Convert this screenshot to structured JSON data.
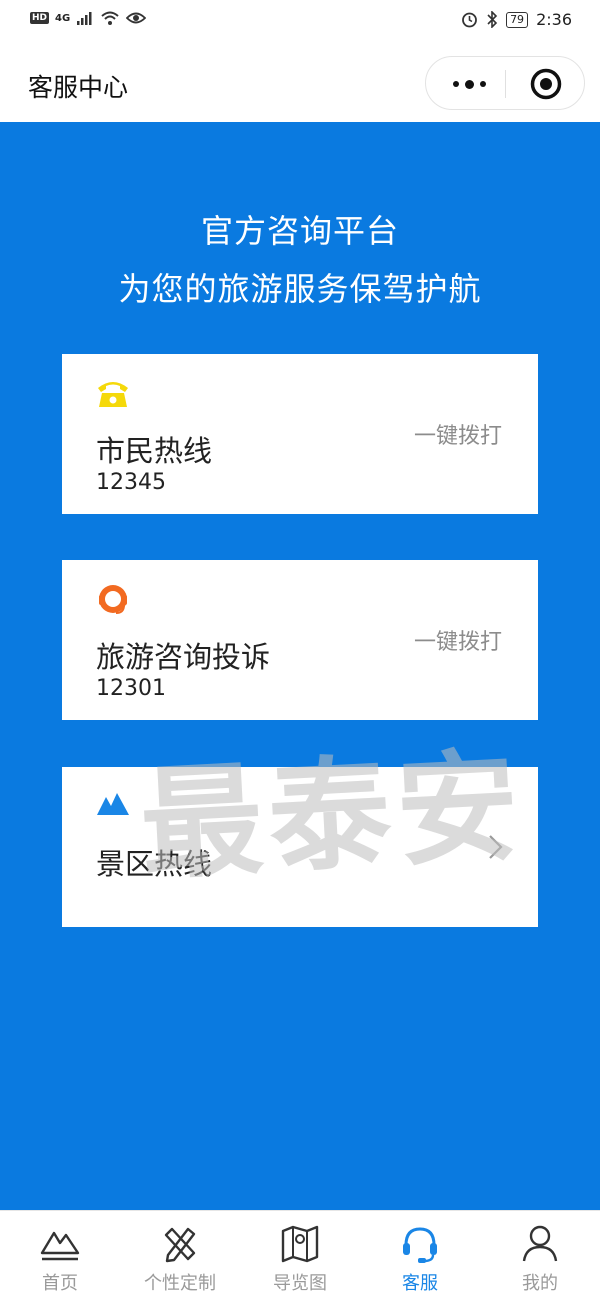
{
  "status_bar": {
    "hd_badge": "HD",
    "network": "4G",
    "battery": "79",
    "time": "2:36",
    "icons": [
      "signal-icon",
      "wifi-icon",
      "eye-icon",
      "alarm-icon",
      "bluetooth-icon",
      "battery-icon"
    ]
  },
  "navbar": {
    "title": "客服中心",
    "capsule_icons": [
      "more-dots-icon",
      "close-target-icon"
    ]
  },
  "hero": {
    "line1": "官方咨询平台",
    "line2": "为您的旅游服务保驾护航"
  },
  "cards": [
    {
      "title": "市民热线",
      "number": "12345",
      "action": "一键拨打",
      "icon": "telephone-icon",
      "icon_color": "#f5d90a"
    },
    {
      "title": "旅游咨询投诉",
      "number": "12301",
      "action": "一键拨打",
      "icon": "headset-agent-icon",
      "icon_color": "#f26a21"
    },
    {
      "title": "景区热线",
      "icon": "mountain-icon",
      "icon_color": "#1a86e6",
      "trailing_icon": "chevron-right-icon"
    }
  ],
  "watermark": "最泰安",
  "tabbar": {
    "items": [
      {
        "label": "首页",
        "icon": "home-mountain-icon",
        "active": false
      },
      {
        "label": "个性定制",
        "icon": "pencil-ruler-icon",
        "active": false
      },
      {
        "label": "导览图",
        "icon": "map-pin-icon",
        "active": false
      },
      {
        "label": "客服",
        "icon": "headset-icon",
        "active": true
      },
      {
        "label": "我的",
        "icon": "user-icon",
        "active": false
      }
    ]
  },
  "colors": {
    "primary_blue": "#0a7ae0",
    "tab_active": "#1a86e6",
    "tab_inactive": "#9a9a9a",
    "action_gray": "#8c8c8c"
  }
}
